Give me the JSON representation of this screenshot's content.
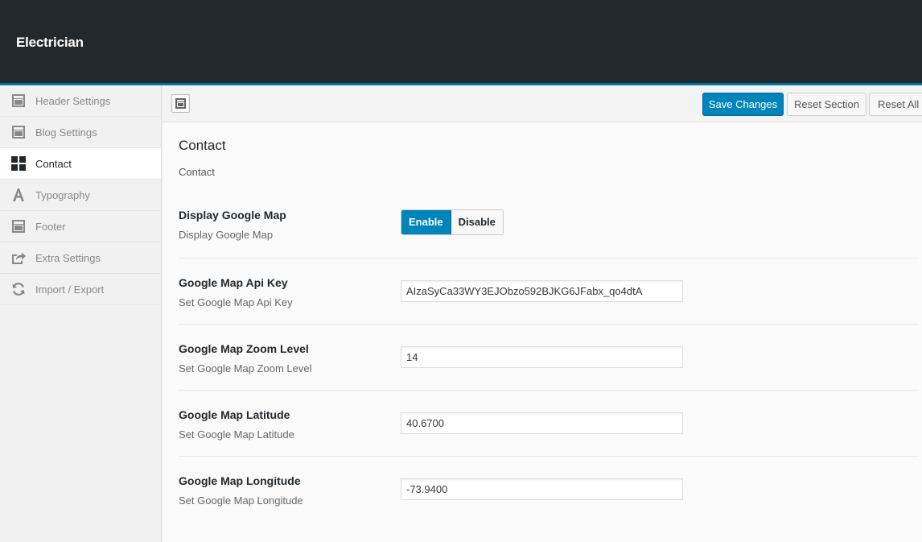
{
  "app": {
    "title": "Electrician"
  },
  "colors": {
    "accent": "#0073aa",
    "primary_button": "#0085ba",
    "topbar": "#23282d"
  },
  "sidebar": {
    "items": [
      {
        "label": "Header Settings",
        "icon": "layout-icon",
        "active": false
      },
      {
        "label": "Blog Settings",
        "icon": "layout-icon",
        "active": false
      },
      {
        "label": "Contact",
        "icon": "grid-icon",
        "active": true
      },
      {
        "label": "Typography",
        "icon": "typography-icon",
        "active": false
      },
      {
        "label": "Footer",
        "icon": "layout-icon",
        "active": false
      },
      {
        "label": "Extra Settings",
        "icon": "share-icon",
        "active": false
      },
      {
        "label": "Import / Export",
        "icon": "refresh-icon",
        "active": false
      }
    ]
  },
  "toolbar": {
    "save_label": "Save Changes",
    "reset_section_label": "Reset Section",
    "reset_all_label": "Reset All"
  },
  "section": {
    "title": "Contact",
    "description": "Contact",
    "fields": [
      {
        "label": "Display Google Map",
        "subtitle": "Display Google Map",
        "type": "switch",
        "on_label": "Enable",
        "off_label": "Disable",
        "value": "Enable"
      },
      {
        "label": "Google Map Api Key",
        "subtitle": "Set Google Map Api Key",
        "type": "text",
        "value": "AIzaSyCa33WY3EJObzo592BJKG6JFabx_qo4dtA"
      },
      {
        "label": "Google Map Zoom Level",
        "subtitle": "Set Google Map Zoom Level",
        "type": "text",
        "value": "14"
      },
      {
        "label": "Google Map Latitude",
        "subtitle": "Set Google Map Latitude",
        "type": "text",
        "value": "40.6700"
      },
      {
        "label": "Google Map Longitude",
        "subtitle": "Set Google Map Longitude",
        "type": "text",
        "value": "-73.9400"
      }
    ]
  }
}
